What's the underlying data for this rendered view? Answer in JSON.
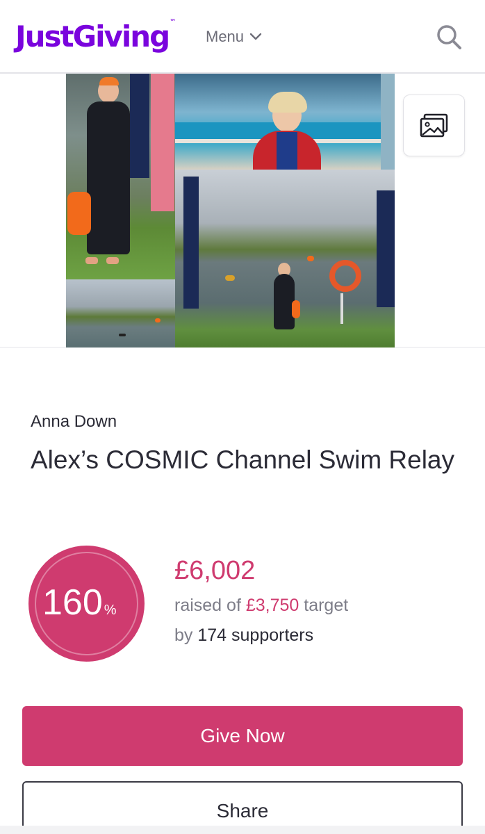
{
  "header": {
    "logo_text": "JustGiving",
    "logo_tm": "™",
    "menu_label": "Menu",
    "brand_color": "#7a04dd"
  },
  "hero": {
    "gallery_icon": "image-gallery-icon"
  },
  "page": {
    "owner_name": "Anna Down",
    "title": "Alex’s COSMIC Channel Swim Relay"
  },
  "progress": {
    "percent": "160",
    "percent_symbol": "%",
    "raised_amount": "£6,002",
    "raised_prefix": "raised of ",
    "target_amount": "£3,750",
    "target_suffix": " target",
    "supporters_prefix": "by ",
    "supporters_text": "174 supporters",
    "accent_color": "#cf3b6f"
  },
  "actions": {
    "give_label": "Give Now",
    "share_label": "Share"
  }
}
